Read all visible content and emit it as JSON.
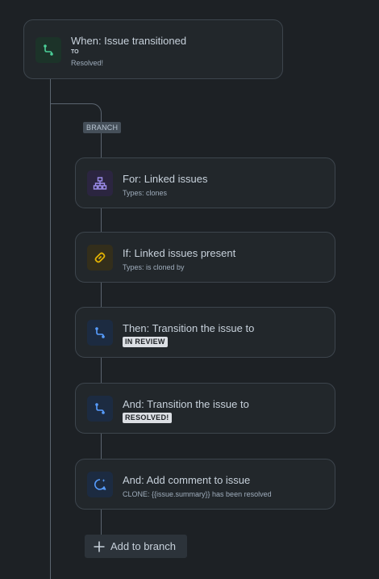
{
  "trigger": {
    "title": "When: Issue transitioned",
    "to_label": "TO",
    "status": "Resolved!",
    "icon": "transition-icon",
    "icon_color": "#4bce97"
  },
  "branch": {
    "badge": "BRANCH"
  },
  "steps": [
    {
      "title": "For: Linked issues",
      "sub": "Types: clones",
      "icon": "hierarchy-icon",
      "icon_color": "#9f8fef"
    },
    {
      "title": "If: Linked issues present",
      "sub": "Types: is cloned by",
      "icon": "link-icon",
      "icon_color": "#e2b203"
    },
    {
      "title": "Then: Transition the issue to",
      "lozenge": "IN REVIEW",
      "icon": "transition-icon",
      "icon_color": "#579dff"
    },
    {
      "title": "And: Transition the issue to",
      "lozenge": "RESOLVED!",
      "icon": "transition-icon",
      "icon_color": "#579dff"
    },
    {
      "title": "And: Add comment to issue",
      "sub": "CLONE: {{issue.summary}} has been resolved",
      "icon": "comment-icon",
      "icon_color": "#579dff"
    }
  ],
  "add_button": {
    "label": "Add to branch",
    "icon": "plus-icon"
  }
}
